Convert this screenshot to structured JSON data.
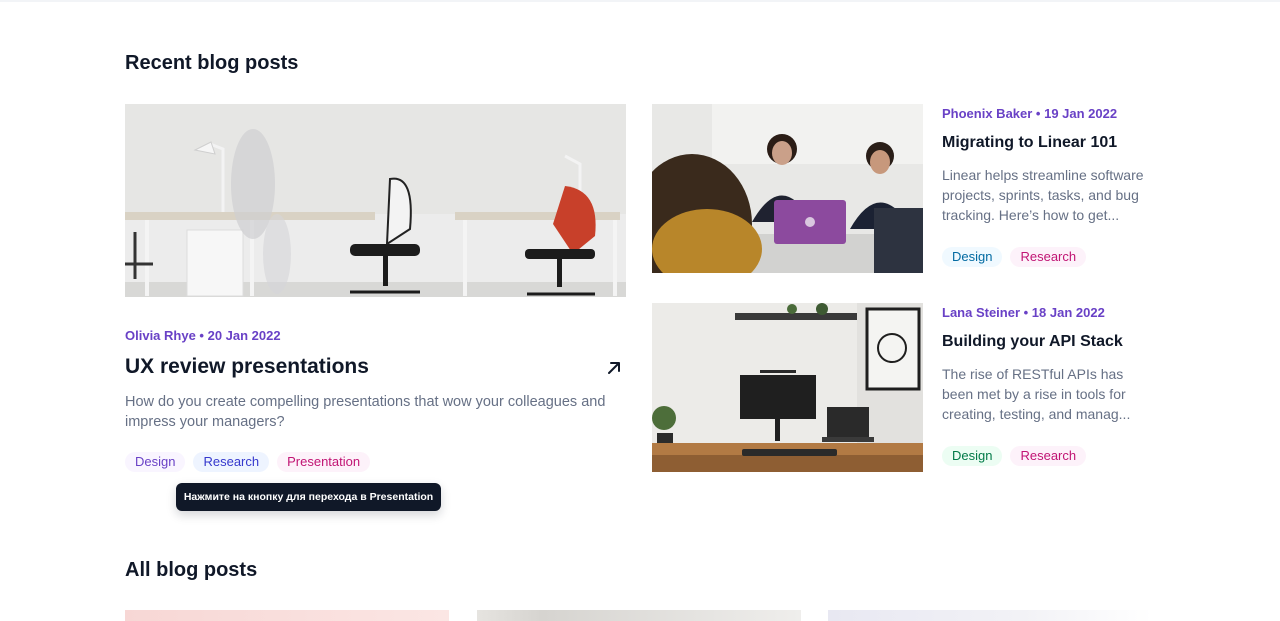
{
  "recent": {
    "title": "Recent blog posts",
    "featured": {
      "meta": "Olivia Rhye • 20 Jan 2022",
      "title": "UX review presentations",
      "description": "How do you create compelling presentations that wow your colleagues and impress your managers?",
      "tags": [
        "Design",
        "Research",
        "Presentation"
      ],
      "tooltip": "Нажмите на кнопку для перехода в Presentation",
      "image_icon": "office-desks-photo",
      "arrow_icon": "arrow-up-right-icon"
    },
    "side_posts": [
      {
        "meta": "Phoenix Baker • 19 Jan 2022",
        "title": "Migrating to Linear 101",
        "description": "Linear helps streamline software projects, sprints, tasks, and bug tracking. Here’s how to get...",
        "tags": [
          "Design",
          "Research"
        ],
        "image_icon": "team-meeting-photo"
      },
      {
        "meta": "Lana Steiner • 18 Jan 2022",
        "title": "Building your API Stack",
        "description": "The rise of RESTful APIs has been met by a rise in tools for creating, testing, and manag...",
        "tags": [
          "Design",
          "Research"
        ],
        "image_icon": "desk-setup-photo"
      }
    ]
  },
  "all": {
    "title": "All blog posts"
  },
  "colors": {
    "accent": "#6941c6",
    "heading": "#101828",
    "body_text": "#667085",
    "tooltip_bg": "#101828"
  }
}
